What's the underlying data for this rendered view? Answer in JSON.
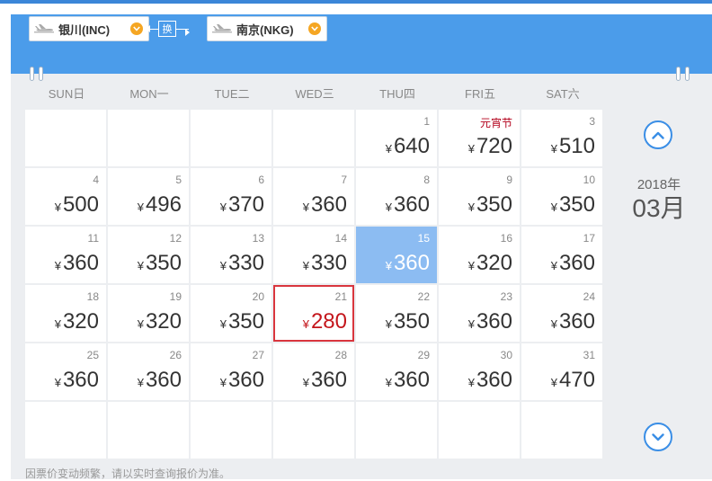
{
  "route": {
    "from_city": "银川(INC)",
    "to_city": "南京(NKG)",
    "swap_label": "换"
  },
  "weekdays": [
    "SUN日",
    "MON一",
    "TUE二",
    "WED三",
    "THU四",
    "FRI五",
    "SAT六"
  ],
  "calendar": {
    "year_label": "2018年",
    "month_label": "03月",
    "currency": "¥",
    "selected_day": "15",
    "lowest_day": "21",
    "days": [
      {
        "day": "1",
        "price": "640"
      },
      {
        "day": "元宵节",
        "price": "720",
        "holiday": true
      },
      {
        "day": "3",
        "price": "510"
      },
      {
        "day": "4",
        "price": "500"
      },
      {
        "day": "5",
        "price": "496"
      },
      {
        "day": "6",
        "price": "370"
      },
      {
        "day": "7",
        "price": "360"
      },
      {
        "day": "8",
        "price": "360"
      },
      {
        "day": "9",
        "price": "350"
      },
      {
        "day": "10",
        "price": "350"
      },
      {
        "day": "11",
        "price": "360"
      },
      {
        "day": "12",
        "price": "350"
      },
      {
        "day": "13",
        "price": "330"
      },
      {
        "day": "14",
        "price": "330"
      },
      {
        "day": "15",
        "price": "360"
      },
      {
        "day": "16",
        "price": "320"
      },
      {
        "day": "17",
        "price": "360"
      },
      {
        "day": "18",
        "price": "320"
      },
      {
        "day": "19",
        "price": "320"
      },
      {
        "day": "20",
        "price": "350"
      },
      {
        "day": "21",
        "price": "280"
      },
      {
        "day": "22",
        "price": "350"
      },
      {
        "day": "23",
        "price": "360"
      },
      {
        "day": "24",
        "price": "360"
      },
      {
        "day": "25",
        "price": "360"
      },
      {
        "day": "26",
        "price": "360"
      },
      {
        "day": "27",
        "price": "360"
      },
      {
        "day": "28",
        "price": "360"
      },
      {
        "day": "29",
        "price": "360"
      },
      {
        "day": "30",
        "price": "360"
      },
      {
        "day": "31",
        "price": "470"
      }
    ]
  },
  "footnote": "因票价变动频繁，请以实时查询报价为准。",
  "icons": {
    "plane": "plane-icon",
    "dropdown": "chevron-down-icon",
    "prev_month": "chevron-up-circle-icon",
    "next_month": "chevron-down-circle-icon"
  },
  "colors": {
    "header": "#4b9cea",
    "selected": "#8cbcf2",
    "lowest_border": "#d9363e",
    "lowest_price": "#c4161c",
    "accent_orange": "#f5a623",
    "nav_blue": "#3a8ee6"
  }
}
